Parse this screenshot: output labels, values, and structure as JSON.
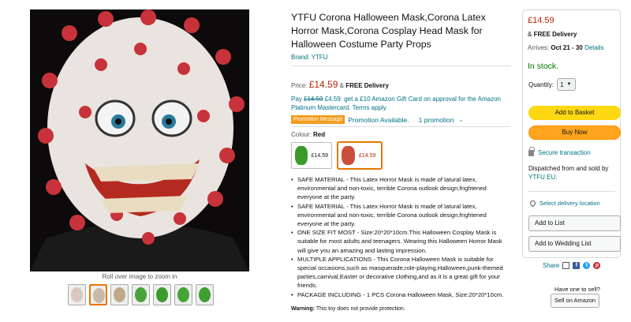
{
  "product": {
    "title": "YTFU Corona Halloween Mask,Corona Latex Horror Mask,Corona Cosplay Head Mask for Halloween Costume Party Props",
    "brand": "Brand: YTFU",
    "price_label": "Price:",
    "price": "£14.59",
    "free_delivery_amp": "&",
    "free_delivery": "FREE Delivery",
    "gift_pay": "Pay",
    "gift_old": "£14.59",
    "gift_rest": "£4.59: get a £10 Amazon Gift Card on approval for the Amazon Platinum Mastercard. Terms apply.",
    "promo_badge": "Promotion Message",
    "promo_text": "Promotion Available.",
    "promo_count": "1 promotion",
    "colour_label": "Colour:",
    "colour_value": "Red",
    "swatches": [
      {
        "price": "£14.59",
        "color": "#3a9a2a",
        "selected": false
      },
      {
        "price": "£14.59",
        "color": "#c94f3a",
        "selected": true
      }
    ],
    "bullets": [
      "SAFE MATERIAL - This Latex Horror Mask is made of latural latex, environmental and non-toxic, terrible Corona outlook design,frightened everyone at the party.",
      "SAFE MATERIAL - This Latex Horror Mask is made of latural latex, environmental and non-toxic, terrible Corona outlook design,frightened everyone at the party.",
      "ONE SIZE FIT MOST - Size:20*20*10cm.This Halloween Cosplay Mask is suitable for most adults and teenagers. Wearing this Halloween Horror Mask will give you an amazing and lasting impression.",
      "MULTIPLE APPLICATIONS - This Corona Halloween Mask is suitable for special occasions,such as masquerade,role-playing,Halloween,punk-themed parties,carnival,Easter or decorative clothing,and as it is a great gift for your friends.",
      "PACKAGE INCLUDING - 1 PCS Corona Halloween Mask, Size:20*20*10cm."
    ],
    "warning_label": "Warning:",
    "warning_text": "This toy does not provide protection."
  },
  "gallery": {
    "zoom_hint": "Roll over image to zoom in",
    "thumbnails": [
      {
        "color": "#d9c9c0",
        "active": false
      },
      {
        "color": "#c9b8a8",
        "active": true
      },
      {
        "color": "#bfa98a",
        "active": false
      },
      {
        "color": "#49a23a",
        "active": false
      },
      {
        "color": "#3b9a2c",
        "active": false
      },
      {
        "color": "#44a535",
        "active": false
      },
      {
        "color": "#3e9e30",
        "active": false
      }
    ]
  },
  "buybox": {
    "price": "£14.59",
    "free_amp": "&",
    "free_delivery": "FREE Delivery",
    "arrives_label": "Arrives:",
    "arrives_date": "Oct 21 - 30",
    "details_link": "Details",
    "stock": "In stock.",
    "quantity_label": "Quantity:",
    "quantity_value": "1",
    "add_to_basket": "Add to Basket",
    "buy_now": "Buy Now",
    "secure": "Secure transaction",
    "dispatch_prefix": "Dispatched from and sold by",
    "seller": "YTFU EU.",
    "delivery_location": "Select delivery location",
    "add_to_list": "Add to List",
    "add_to_wedding": "Add to Wedding List"
  },
  "share": {
    "label": "Share",
    "have_one": "Have one to sell?",
    "sell_button": "Sell on Amazon"
  },
  "colors": {
    "price_red": "#b12704",
    "link_teal": "#007185",
    "stock_green": "#007600",
    "basket_yellow": "#ffd814",
    "buy_orange": "#ffa41c",
    "promo_orange": "#f39c1f"
  }
}
